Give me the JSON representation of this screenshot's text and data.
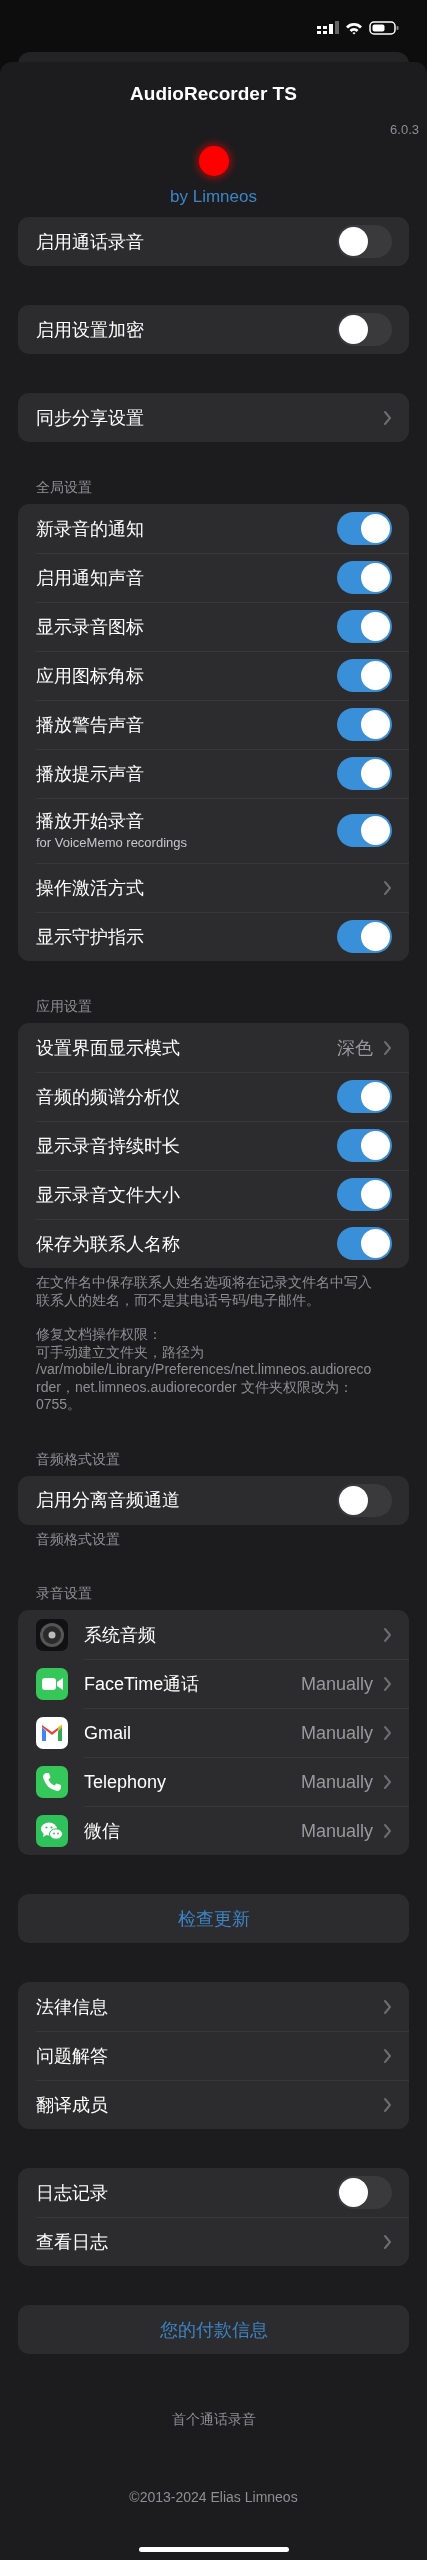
{
  "header": {
    "title": "AudioRecorder TS",
    "version": "6.0.3",
    "byline": "by Limneos"
  },
  "sections": [
    {
      "rows": [
        {
          "kind": "toggle",
          "label": "启用通话录音",
          "on": false
        }
      ]
    },
    {
      "rows": [
        {
          "kind": "toggle",
          "label": "启用设置加密",
          "on": false
        }
      ]
    },
    {
      "rows": [
        {
          "kind": "link",
          "label": "同步分享设置"
        }
      ]
    },
    {
      "header": "全局设置",
      "rows": [
        {
          "kind": "toggle",
          "label": "新录音的通知",
          "on": true
        },
        {
          "kind": "toggle",
          "label": "启用通知声音",
          "on": true
        },
        {
          "kind": "toggle",
          "label": "显示录音图标",
          "on": true
        },
        {
          "kind": "toggle",
          "label": "应用图标角标",
          "on": true
        },
        {
          "kind": "toggle",
          "label": "播放警告声音",
          "on": true
        },
        {
          "kind": "toggle",
          "label": "播放提示声音",
          "on": true
        },
        {
          "kind": "toggle",
          "label": "播放开始录音",
          "sublabel": "for VoiceMemo recordings",
          "on": true
        },
        {
          "kind": "link",
          "label": "操作激活方式"
        },
        {
          "kind": "toggle",
          "label": "显示守护指示",
          "on": true
        }
      ]
    },
    {
      "header": "应用设置",
      "rows": [
        {
          "kind": "link",
          "label": "设置界面显示模式",
          "value": "深色"
        },
        {
          "kind": "toggle",
          "label": "音频的频谱分析仪",
          "on": true
        },
        {
          "kind": "toggle",
          "label": "显示录音持续时长",
          "on": true
        },
        {
          "kind": "toggle",
          "label": "显示录音文件大小",
          "on": true
        },
        {
          "kind": "toggle",
          "label": "保存为联系人名称",
          "on": true
        }
      ],
      "footer": [
        [
          "在文件名中保存联系人姓名选项将在记录文件名中写入联系人的姓名，而不是其电话号码/电子邮件。"
        ],
        [
          "修复文档操作权限：",
          "可手动建立文件夹，路径为 /var/mobile/Library/Preferences/net.limneos.audiorecorder，net.limneos.audiorecorder 文件夹权限改为：0755。"
        ]
      ]
    },
    {
      "header": "音频格式设置",
      "rows": [
        {
          "kind": "toggle",
          "label": "启用分离音频通道",
          "on": false
        }
      ],
      "footer": [
        [
          "音频格式设置"
        ]
      ]
    },
    {
      "header": "录音设置",
      "rows": [
        {
          "kind": "app",
          "label": "系统音频"
        },
        {
          "kind": "app",
          "label": "FaceTime通话",
          "value": "Manually"
        },
        {
          "kind": "app",
          "label": "Gmail",
          "value": "Manually"
        },
        {
          "kind": "app",
          "label": "Telephony",
          "value": "Manually"
        },
        {
          "kind": "app",
          "label": "微信",
          "value": "Manually"
        }
      ]
    },
    {
      "rows": [
        {
          "kind": "button",
          "label": "检查更新"
        }
      ]
    },
    {
      "rows": [
        {
          "kind": "link",
          "label": "法律信息"
        },
        {
          "kind": "link",
          "label": "问题解答"
        },
        {
          "kind": "link",
          "label": "翻译成员"
        }
      ]
    },
    {
      "rows": [
        {
          "kind": "toggle",
          "label": "日志记录",
          "on": false
        },
        {
          "kind": "link",
          "label": "查看日志"
        }
      ]
    },
    {
      "rows": [
        {
          "kind": "button",
          "label": "您的付款信息"
        }
      ]
    }
  ],
  "footer": {
    "caption": "首个通话录音",
    "copyright": "©2013-2024 Elias Limneos"
  }
}
